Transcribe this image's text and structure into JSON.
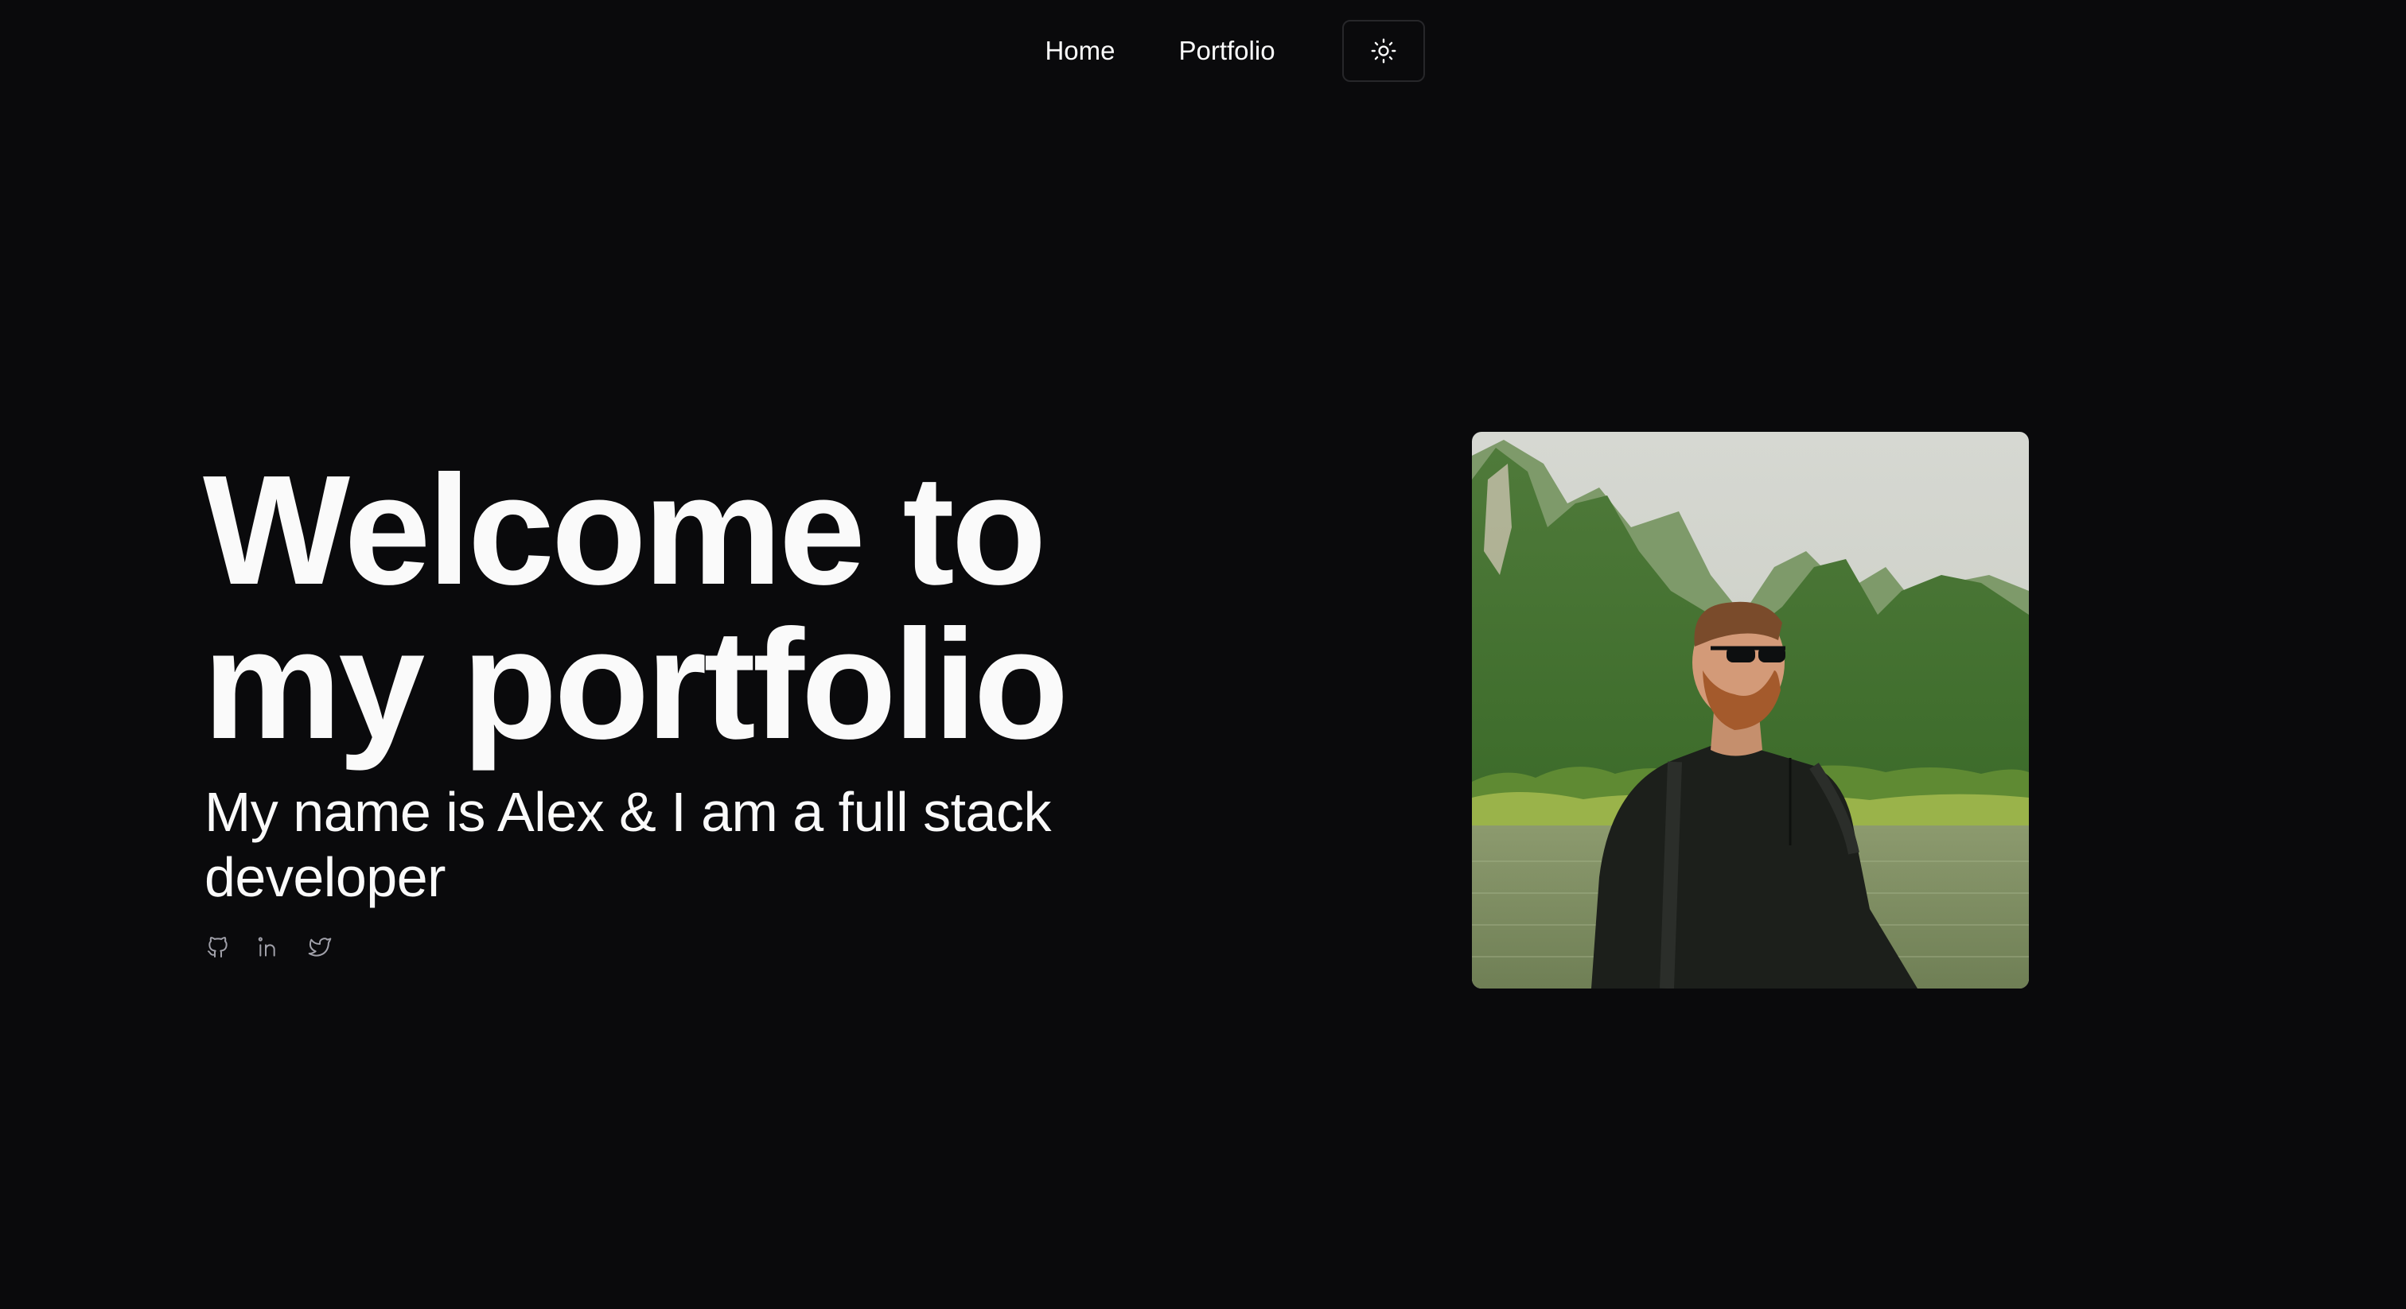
{
  "nav": {
    "links": [
      {
        "label": "Home"
      },
      {
        "label": "Portfolio"
      }
    ],
    "theme_toggle_icon": "sun-icon"
  },
  "hero": {
    "title": "Welcome to my portfolio",
    "subtitle": "My name is Alex & I am a full stack developer",
    "socials": [
      {
        "icon": "github-icon"
      },
      {
        "icon": "linkedin-icon"
      },
      {
        "icon": "twitter-icon"
      }
    ],
    "photo_subject": "man with sunglasses and beard in front of green karst mountains and a river"
  },
  "colors": {
    "background": "#0a0a0c",
    "text": "#fafafa",
    "border": "#27272a",
    "icon_muted": "#a1a1aa"
  }
}
